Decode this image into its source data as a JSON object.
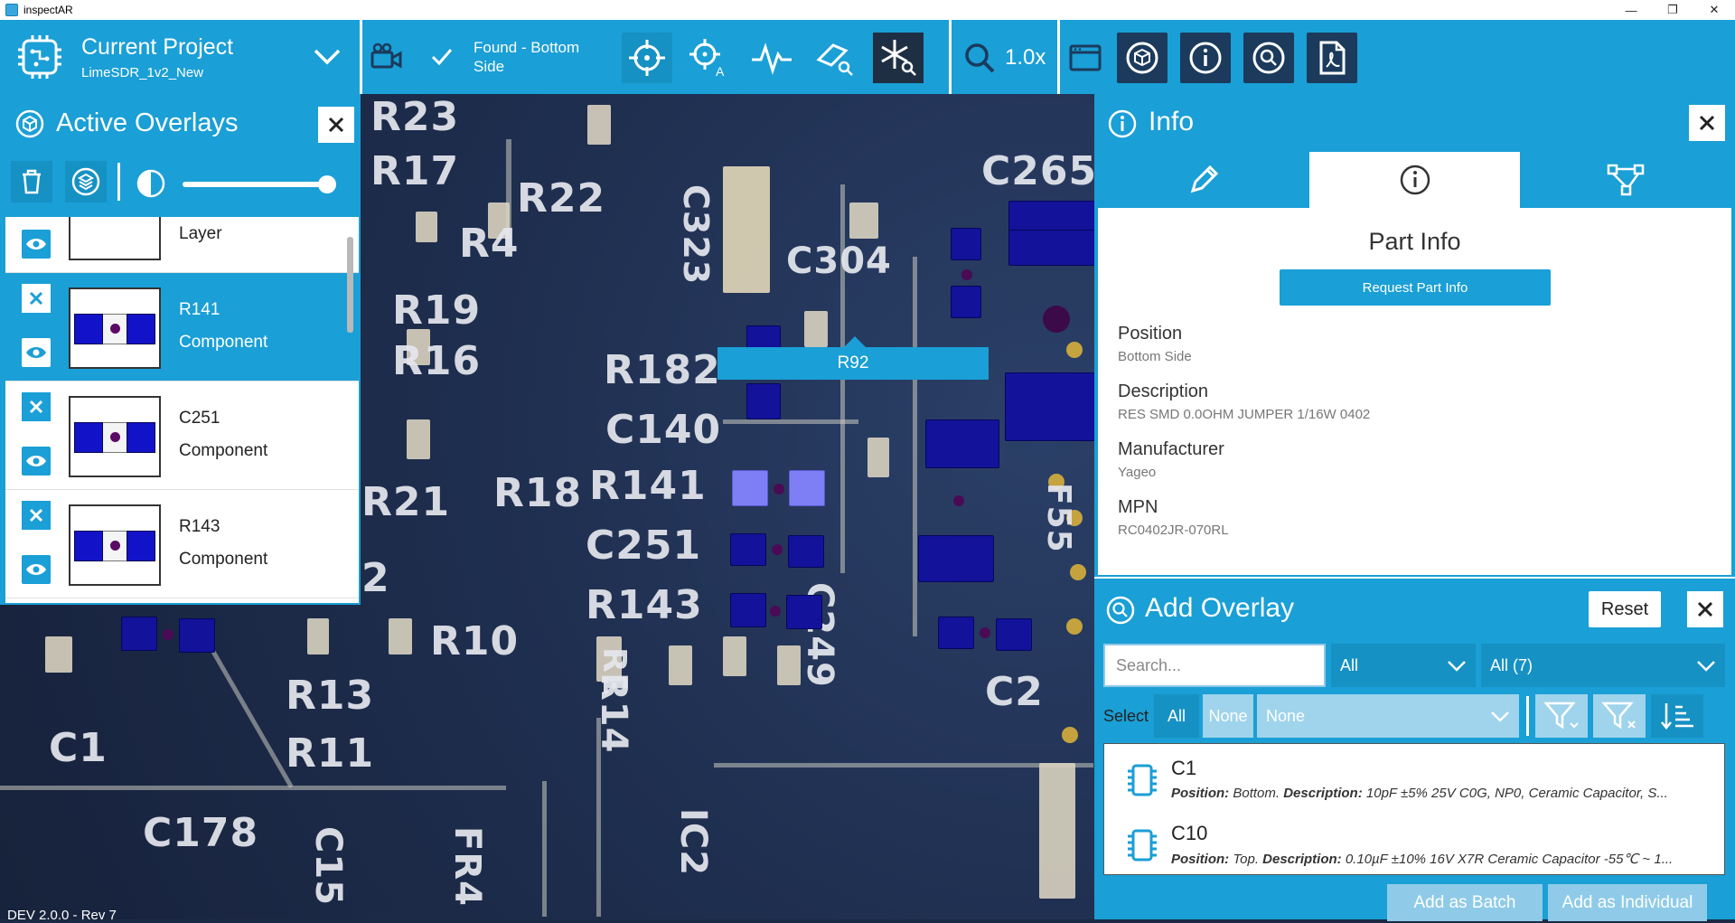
{
  "window": {
    "title": "inspectAR"
  },
  "toolbar": {
    "project_title": "Current Project",
    "project_name": "LimeSDR_1v2_New",
    "found_text": "Found - Bottom Side",
    "zoom_level": "1.0x"
  },
  "active_overlays": {
    "title": "Active Overlays",
    "items": [
      {
        "name": "",
        "type": "Layer"
      },
      {
        "name": "R141",
        "type": "Component"
      },
      {
        "name": "C251",
        "type": "Component"
      },
      {
        "name": "R143",
        "type": "Component"
      }
    ]
  },
  "tooltip": {
    "label": "R92"
  },
  "version": "DEV 2.0.0 - Rev 7",
  "silkscreen": [
    "R23",
    "R17",
    "R22",
    "R4",
    "R19",
    "R16",
    "R21",
    "R18",
    "R141",
    "R182",
    "C140",
    "C251",
    "R143",
    "R10",
    "R13",
    "R11",
    "C1",
    "C178",
    "C265",
    "C304",
    "C249",
    "C323",
    "C2",
    "R14",
    "C15",
    "FR4",
    "IC2",
    "R1",
    "2",
    "F55"
  ],
  "info": {
    "title": "Info",
    "part_info_title": "Part Info",
    "request_button": "Request Part Info",
    "fields": [
      {
        "label": "Position",
        "value": "Bottom Side"
      },
      {
        "label": "Description",
        "value": "RES SMD 0.0OHM JUMPER 1/16W 0402"
      },
      {
        "label": "Manufacturer",
        "value": "Yageo"
      },
      {
        "label": "MPN",
        "value": "RC0402JR-070RL"
      }
    ]
  },
  "add_overlay": {
    "title": "Add Overlay",
    "reset_label": "Reset",
    "search_placeholder": "Search...",
    "dropdown_1": "All",
    "dropdown_2": "All (7)",
    "select_label": "Select",
    "select_all": "All",
    "select_none": "None",
    "dropdown_3": "None",
    "results": [
      {
        "name": "C1",
        "position_label": "Position:",
        "position": "Bottom.",
        "desc_label": "Description:",
        "description": "10pF ±5% 25V C0G, NP0, Ceramic Capacitor, S..."
      },
      {
        "name": "C10",
        "position_label": "Position:",
        "position": "Top.",
        "desc_label": "Description:",
        "description": "0.10µF ±10% 16V X7R Ceramic Capacitor -55℃ ~ 1..."
      }
    ],
    "add_batch": "Add as Batch",
    "add_individual": "Add as Individual"
  },
  "colors": {
    "accent": "#1a9fd6",
    "component": "#12129a",
    "selected_component": "#7f7ff5"
  }
}
